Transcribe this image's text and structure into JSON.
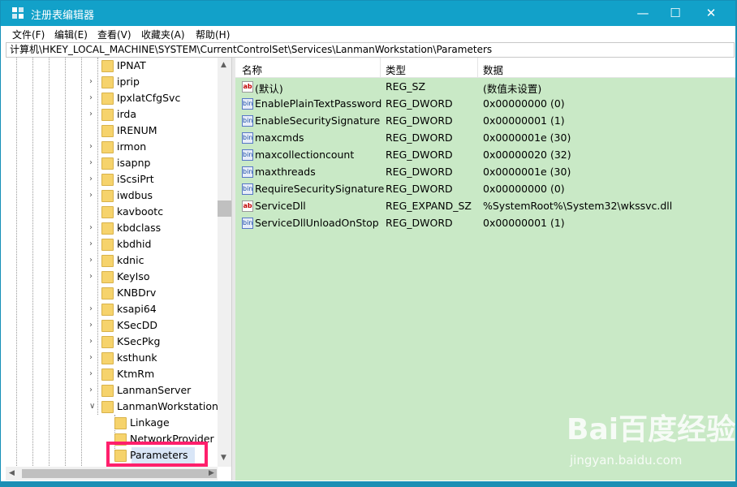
{
  "window": {
    "title": "注册表编辑器",
    "controls": {
      "minimize": "—",
      "maximize": "☐",
      "close": "✕"
    }
  },
  "menu": [
    "文件(F)",
    "编辑(E)",
    "查看(V)",
    "收藏夹(A)",
    "帮助(H)"
  ],
  "address": "计算机\\HKEY_LOCAL_MACHINE\\SYSTEM\\CurrentControlSet\\Services\\LanmanWorkstation\\Parameters",
  "tree": {
    "items": [
      {
        "label": "IPNAT",
        "expand": ""
      },
      {
        "label": "iprip",
        "expand": ">"
      },
      {
        "label": "IpxlatCfgSvc",
        "expand": ">"
      },
      {
        "label": "irda",
        "expand": ">"
      },
      {
        "label": "IRENUM",
        "expand": ""
      },
      {
        "label": "irmon",
        "expand": ">"
      },
      {
        "label": "isapnp",
        "expand": ">"
      },
      {
        "label": "iScsiPrt",
        "expand": ">"
      },
      {
        "label": "iwdbus",
        "expand": ">"
      },
      {
        "label": "kavbootc",
        "expand": ""
      },
      {
        "label": "kbdclass",
        "expand": ">"
      },
      {
        "label": "kbdhid",
        "expand": ">"
      },
      {
        "label": "kdnic",
        "expand": ">"
      },
      {
        "label": "KeyIso",
        "expand": ">"
      },
      {
        "label": "KNBDrv",
        "expand": ""
      },
      {
        "label": "ksapi64",
        "expand": ">"
      },
      {
        "label": "KSecDD",
        "expand": ">"
      },
      {
        "label": "KSecPkg",
        "expand": ">"
      },
      {
        "label": "ksthunk",
        "expand": ">"
      },
      {
        "label": "KtmRm",
        "expand": ">"
      },
      {
        "label": "LanmanServer",
        "expand": ">"
      },
      {
        "label": "LanmanWorkstation",
        "expand": "v"
      }
    ],
    "children": [
      {
        "label": "Linkage"
      },
      {
        "label": "NetworkProvider"
      },
      {
        "label": "Parameters"
      }
    ]
  },
  "columns": {
    "name": "名称",
    "type": "类型",
    "data": "数据"
  },
  "values": [
    {
      "icon": "ab",
      "name": "(默认)",
      "type": "REG_SZ",
      "data": "(数值未设置)"
    },
    {
      "icon": "bin",
      "name": "EnablePlainTextPassword",
      "type": "REG_DWORD",
      "data": "0x00000000 (0)"
    },
    {
      "icon": "bin",
      "name": "EnableSecuritySignature",
      "type": "REG_DWORD",
      "data": "0x00000001 (1)"
    },
    {
      "icon": "bin",
      "name": "maxcmds",
      "type": "REG_DWORD",
      "data": "0x0000001e (30)"
    },
    {
      "icon": "bin",
      "name": "maxcollectioncount",
      "type": "REG_DWORD",
      "data": "0x00000020 (32)"
    },
    {
      "icon": "bin",
      "name": "maxthreads",
      "type": "REG_DWORD",
      "data": "0x0000001e (30)"
    },
    {
      "icon": "bin",
      "name": "RequireSecuritySignature",
      "type": "REG_DWORD",
      "data": "0x00000000 (0)"
    },
    {
      "icon": "ab",
      "name": "ServiceDll",
      "type": "REG_EXPAND_SZ",
      "data": "%SystemRoot%\\System32\\wkssvc.dll"
    },
    {
      "icon": "bin",
      "name": "ServiceDllUnloadOnStop",
      "type": "REG_DWORD",
      "data": "0x00000001 (1)"
    }
  ],
  "watermark": {
    "logo": "Bai百度经验",
    "url": "jingyan.baidu.com"
  },
  "colors": {
    "titlebar": "#12a1c9",
    "listBackground": "#c9e9c6",
    "highlight": "#ff1f6c"
  }
}
